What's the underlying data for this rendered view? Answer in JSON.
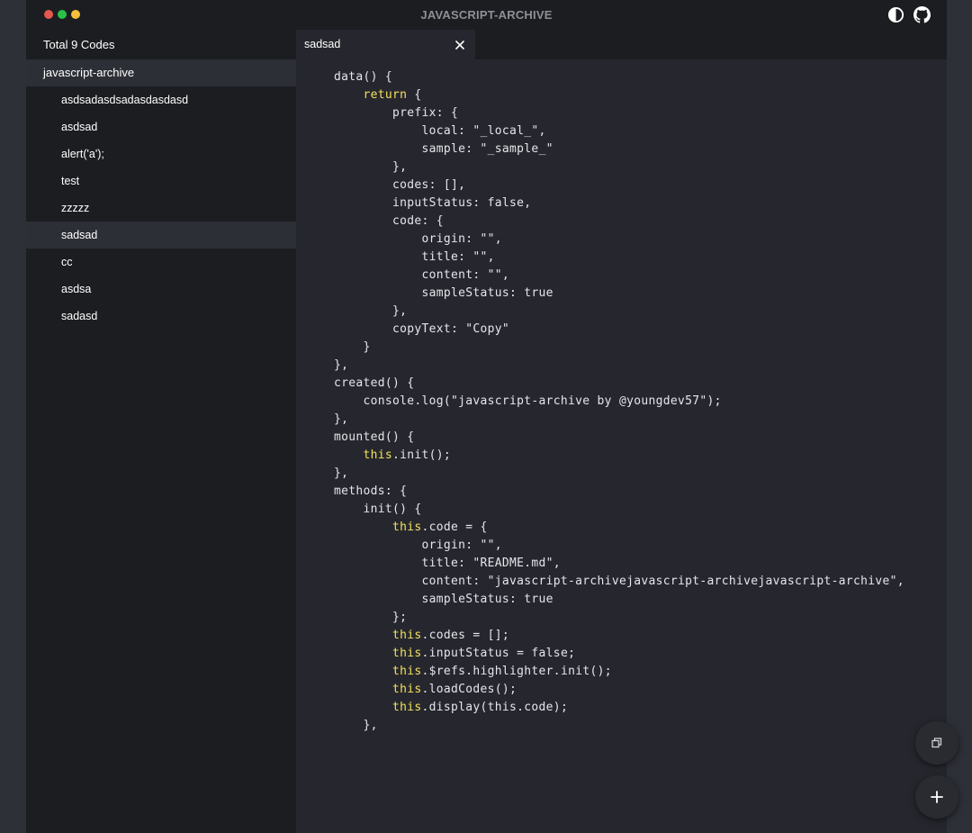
{
  "app": {
    "title": "JAVASCRIPT-ARCHIVE",
    "window_controls": [
      "close",
      "minimize",
      "maximize"
    ],
    "icons": [
      "theme-toggle-icon",
      "github-icon"
    ]
  },
  "colors": {
    "close": "#e5584f",
    "minimize": "#f5bf3d",
    "maximize": "#27c146",
    "keyword": "#f2e15d"
  },
  "sidebar": {
    "header": "Total 9 Codes",
    "group": "javascript-archive",
    "items": [
      {
        "label": "asdsadasdsadasdasdasd"
      },
      {
        "label": "asdsad"
      },
      {
        "label": "alert('a');"
      },
      {
        "label": "test"
      },
      {
        "label": "zzzzz"
      },
      {
        "label": "sadsad",
        "active": true
      },
      {
        "label": "cc"
      },
      {
        "label": "asdsa"
      },
      {
        "label": "sadasd"
      }
    ]
  },
  "tab": {
    "label": "sadsad"
  },
  "code": [
    "data() {",
    "    return {",
    "        prefix: {",
    "            local: \"_local_\",",
    "            sample: \"_sample_\"",
    "        },",
    "        codes: [],",
    "        inputStatus: false,",
    "        code: {",
    "            origin: \"\",",
    "            title: \"\",",
    "            content: \"\",",
    "            sampleStatus: true",
    "        },",
    "        copyText: \"Copy\"",
    "    }",
    "},",
    "created() {",
    "    console.log(\"javascript-archive by @youngdev57\");",
    "},",
    "mounted() {",
    "    this.init();",
    "},",
    "methods: {",
    "    init() {",
    "        this.code = {",
    "            origin: \"\",",
    "            title: \"README.md\",",
    "            content: \"javascript-archivejavascript-archivejavascript-archive\",",
    "            sampleStatus: true",
    "        };",
    "        this.codes = [];",
    "        this.inputStatus = false;",
    "        this.$refs.highlighter.init();",
    "        this.loadCodes();",
    "        this.display(this.code);",
    "    },"
  ],
  "keywords": [
    "return",
    "this"
  ],
  "fabs": {
    "copy_icon": "copy-icon",
    "add_icon": "plus-icon"
  }
}
